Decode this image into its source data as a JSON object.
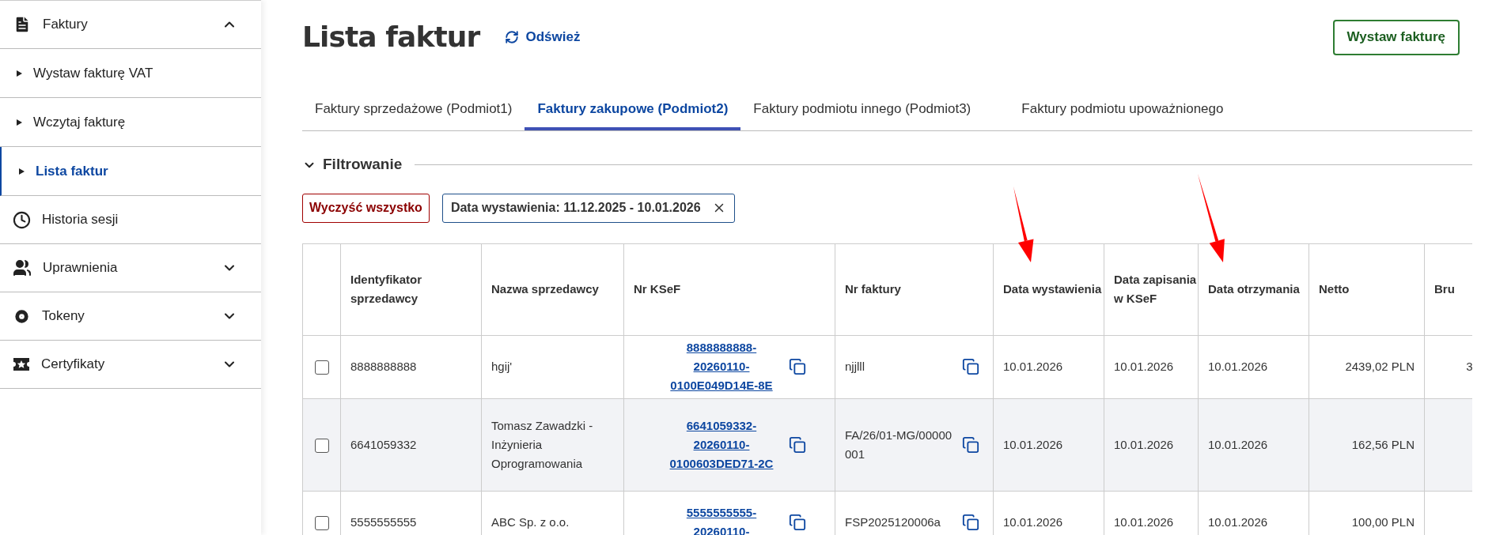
{
  "sidebar": {
    "items": [
      {
        "label": "Faktury",
        "kind": "group",
        "expanded": true,
        "children": [
          {
            "label": "Wystaw fakturę VAT",
            "selected": false
          },
          {
            "label": "Wczytaj fakturę",
            "selected": false
          },
          {
            "label": "Lista faktur",
            "selected": true
          }
        ]
      },
      {
        "label": "Historia sesji",
        "kind": "link"
      },
      {
        "label": "Uprawnienia",
        "kind": "group",
        "expanded": false
      },
      {
        "label": "Tokeny",
        "kind": "group",
        "expanded": false
      },
      {
        "label": "Certyfikaty",
        "kind": "group",
        "expanded": false
      }
    ]
  },
  "header": {
    "title": "Lista faktur",
    "refresh": "Odśwież",
    "primary_button": "Wystaw fakturę"
  },
  "tabs": [
    {
      "label": "Faktury sprzedażowe (Podmiot1)",
      "selected": false
    },
    {
      "label": "Faktury zakupowe (Podmiot2)",
      "selected": true
    },
    {
      "label": "Faktury podmiotu innego (Podmiot3)",
      "selected": false
    },
    {
      "label": "Faktury podmiotu upoważnionego",
      "selected": false
    }
  ],
  "filter": {
    "title": "Filtrowanie",
    "expanded": true,
    "clear_button": "Wyczyść wszystko",
    "chips": [
      {
        "label": "Data wystawienia: 11.12.2025 - 10.01.2026"
      }
    ]
  },
  "table": {
    "columns": [
      "Identyfikator sprzedawcy",
      "Nazwa sprzedawcy",
      "Nr KSeF",
      "Nr faktury",
      "Data wystawienia",
      "Data zapisania w KSeF",
      "Data otrzymania",
      "Netto",
      "Bru"
    ],
    "rows": [
      {
        "checked": false,
        "cells": [
          "8888888888",
          "hgij'",
          "8888888888-20260110-0100E049D14E-8E",
          "njjlll",
          "10.01.2026",
          "10.01.2026",
          "10.01.2026",
          "2439,02 PLN",
          "3"
        ]
      },
      {
        "checked": false,
        "cells": [
          "6641059332",
          "Tomasz Zawadzki - Inżynieria Oprogramowania",
          "6641059332-20260110-0100603DED71-2C",
          "FA/26/01-MG/00000001",
          "10.01.2026",
          "10.01.2026",
          "10.01.2026",
          "162,56 PLN",
          ""
        ]
      },
      {
        "checked": false,
        "cells": [
          "5555555555",
          "ABC Sp. z o.o.",
          "5555555555-20260110-",
          "FSP2025120006a",
          "10.01.2026",
          "10.01.2026",
          "10.01.2026",
          "100,00 PLN",
          ""
        ]
      }
    ]
  }
}
